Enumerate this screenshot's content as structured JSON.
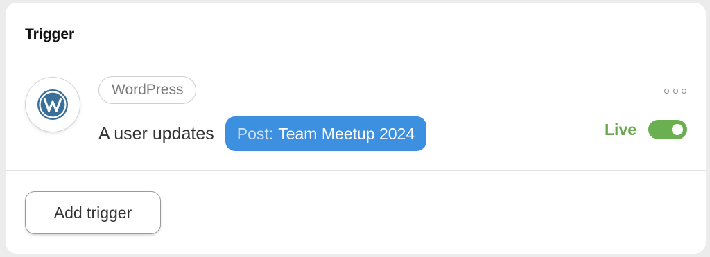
{
  "panel": {
    "title": "Trigger"
  },
  "trigger": {
    "app_name": "WordPress",
    "app_icon": "wordpress-logo-icon",
    "event_text": "A user updates",
    "resource": {
      "type_label": "Post:",
      "value": "Team Meetup 2024"
    },
    "status_label": "Live",
    "status_on": true
  },
  "actions": {
    "add_trigger_label": "Add trigger"
  },
  "colors": {
    "accent_blue": "#3d8fe0",
    "live_green": "#6aa84f",
    "wordpress_blue": "#3a6f9a"
  }
}
